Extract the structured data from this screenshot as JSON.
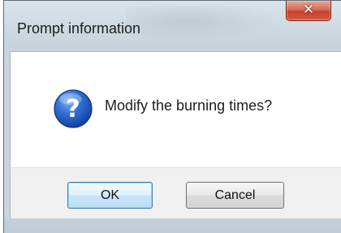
{
  "dialog": {
    "title": "Prompt information",
    "close_icon": "close-icon",
    "message": "Modify the burning times?",
    "message_icon": "question-icon",
    "buttons": {
      "ok_label": "OK",
      "cancel_label": "Cancel"
    }
  },
  "colors": {
    "close_button": "#c7402a",
    "question_icon": "#1f56b8",
    "default_button_border": "#3c7fb1"
  }
}
